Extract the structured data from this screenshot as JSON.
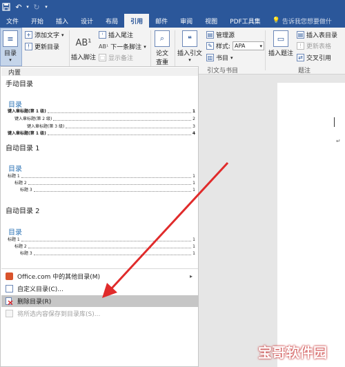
{
  "quick_access": {
    "save_icon": "save-icon",
    "undo_icon": "undo-icon",
    "redo_icon": "redo-icon"
  },
  "tabs": [
    "文件",
    "开始",
    "插入",
    "设计",
    "布局",
    "引用",
    "邮件",
    "审阅",
    "视图",
    "PDF工具集"
  ],
  "active_tab": "引用",
  "tell_me": "告诉我您想要做什",
  "ribbon": {
    "toc_button": "目录",
    "add_text": "添加文字",
    "update_toc": "更新目录",
    "insert_footnote_big": "插入脚注",
    "insert_endnote": "插入尾注",
    "next_footnote": "下一条脚注",
    "show_notes": "显示备注",
    "smart_lookup_line1": "论文",
    "smart_lookup_line2": "查重",
    "insert_citation": "插入引文",
    "manage_sources": "管理源",
    "style_label": "样式:",
    "style_value": "APA",
    "bibliography": "书目",
    "group_citations": "引文与书目",
    "insert_caption": "插入题注",
    "insert_table_of_figures": "插入表目录",
    "update_table": "更新表格",
    "cross_reference": "交叉引用",
    "group_captions": "题注"
  },
  "menu": {
    "section_title": "内置",
    "manual_title": "手动目录",
    "manual_toc_label": "目录",
    "manual_entries": [
      {
        "text": "键入章标题(第 1 级)",
        "page": "1"
      },
      {
        "text": "键入章标题(第 2 级)",
        "page": "2"
      },
      {
        "text": "键入章标题(第 3 级)",
        "page": "3"
      },
      {
        "text": "键入章标题(第 1 级)",
        "page": "4"
      }
    ],
    "auto1_title": "自动目录 1",
    "auto1_toc_label": "目录",
    "auto1_entries": [
      {
        "text": "标题 1",
        "page": "1"
      },
      {
        "text": "标题 2",
        "page": "1"
      },
      {
        "text": "标题 3",
        "page": "1"
      }
    ],
    "auto2_title": "自动目录 2",
    "auto2_toc_label": "目录",
    "auto2_entries": [
      {
        "text": "标题 1",
        "page": "1"
      },
      {
        "text": "标题 2",
        "page": "1"
      },
      {
        "text": "标题 3",
        "page": "1"
      }
    ],
    "office_more": "Office.com 中的其他目录(M)",
    "custom_toc": "自定义目录(C)...",
    "remove_toc": "删除目录(R)",
    "save_selection": "将所选内容保存到目录库(S)..."
  },
  "document": {
    "paragraph_mark": "↵"
  },
  "watermark": "宝哥软件园",
  "colors": {
    "title_bar": "#2b579a",
    "toc_heading": "#2e74b5",
    "arrow": "#e02b2b",
    "hover_item": "#c6c6c6"
  }
}
